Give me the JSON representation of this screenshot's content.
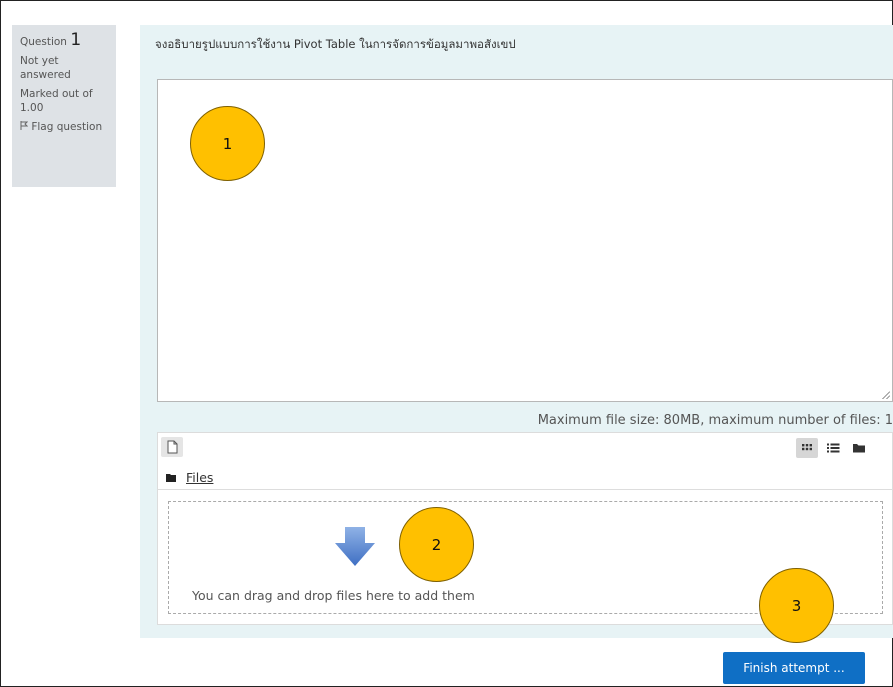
{
  "info": {
    "question_label": "Question",
    "question_number": "1",
    "status": "Not yet answered",
    "marked": "Marked out of 1.00",
    "flag": "Flag question"
  },
  "question_text": "จงอธิบายรูปแบบการใช้งาน Pivot Table ในการจัดการข้อมูลมาพอสังเขป",
  "filepicker": {
    "max_info": "Maximum file size: 80MB, maximum number of files: 1",
    "folder_label": "Files",
    "drop_text": "You can drag and drop files here to add them"
  },
  "callouts": [
    "1",
    "2",
    "3"
  ],
  "finish_label": "Finish attempt ...",
  "colors": {
    "accent": "#0f6fc5",
    "callout": "#ffc000",
    "question_bg": "#e7f3f5"
  }
}
